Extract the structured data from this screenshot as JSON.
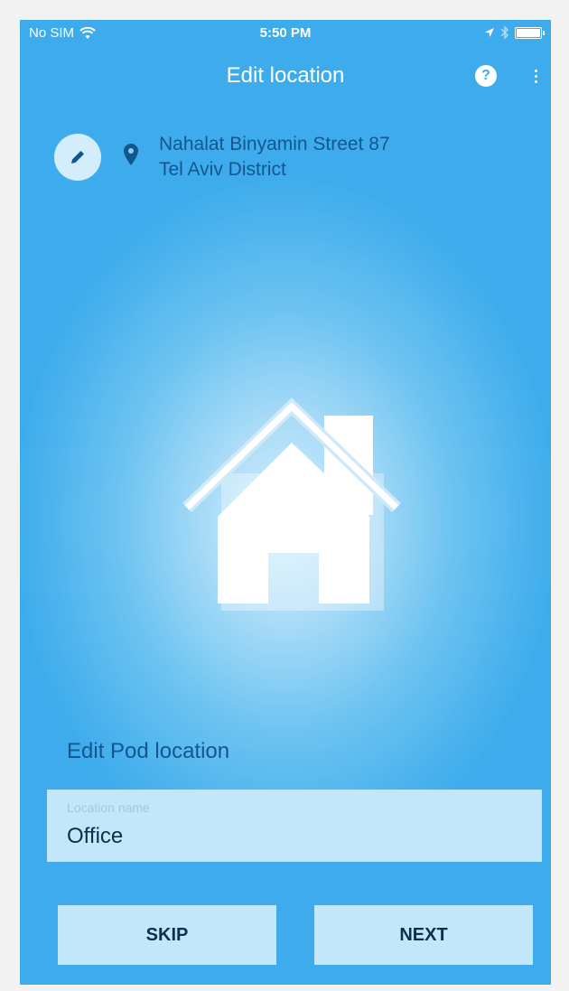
{
  "status_bar": {
    "carrier": "No SIM",
    "time": "5:50 PM"
  },
  "header": {
    "title": "Edit location",
    "help_icon": "question-circle-icon",
    "more_icon": "more-vertical-icon"
  },
  "address": {
    "edit_icon": "pencil-icon",
    "pin_icon": "map-pin-icon",
    "line1": "Nahalat Binyamin Street 87",
    "line2": "Tel Aviv District"
  },
  "illustration": {
    "icon": "house-icon"
  },
  "form": {
    "section_label": "Edit Pod location",
    "location_name_label": "Location name",
    "location_name_value": "Office"
  },
  "actions": {
    "skip_label": "SKIP",
    "next_label": "NEXT"
  },
  "colors": {
    "background": "#3eacec",
    "accent_text": "#12568e",
    "button_bg": "#c3e6fb"
  }
}
